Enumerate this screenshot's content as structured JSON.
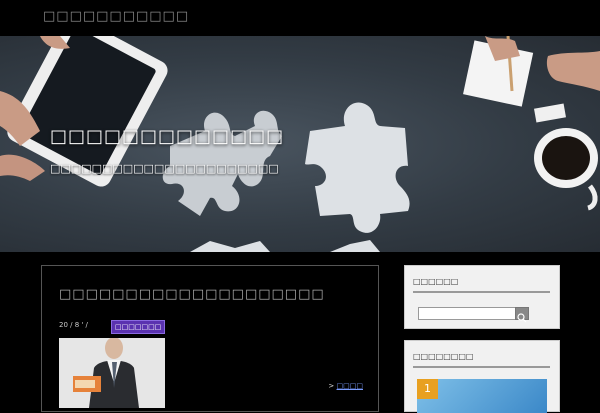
{
  "site": {
    "title": "□□□□□□□□□□□"
  },
  "hero": {
    "title": "□□□□□□□□□□□□□",
    "subtitle": "□□□□□□□□□□□□□□□□□□□□□□"
  },
  "post": {
    "title": "□□□□□□□□□□□□□□□□□□□□",
    "date": "20 / 8 ' /",
    "category": "□□□□□□□",
    "more_prefix": ">",
    "more_label": "□□□□"
  },
  "sidebar": {
    "search_title": "□□□□□□",
    "ranking_title": "□□□□□□□□",
    "rank_number": "1"
  },
  "colors": {
    "accent_badge": "#5a32b0",
    "rank_badge": "#e8a020",
    "background": "#000000"
  }
}
